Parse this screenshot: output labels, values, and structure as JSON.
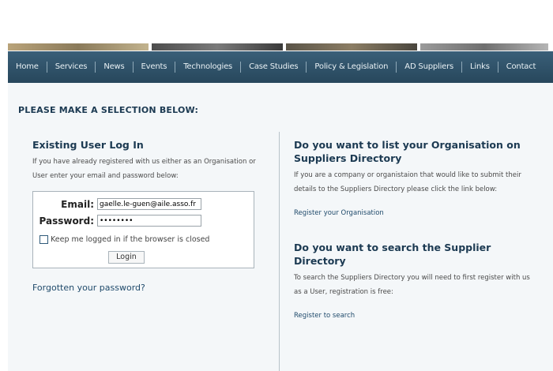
{
  "nav": {
    "items": [
      "Home",
      "Services",
      "News",
      "Events",
      "Technologies",
      "Case Studies",
      "Policy & Legislation",
      "AD Suppliers",
      "Links",
      "Contact"
    ]
  },
  "page": {
    "title": "PLEASE MAKE A SELECTION BELOW:"
  },
  "login": {
    "heading": "Existing User Log In",
    "description": "If you have already registered with us either as an Organisation or User enter your email and password below:",
    "email_label": "Email:",
    "email_value": "gaelle.le-guen@aile.asso.fr",
    "password_label": "Password:",
    "password_value": "password",
    "remember_label": "Keep me logged in if the browser is closed",
    "button_label": "Login",
    "forgot_label": "Forgotten your password?"
  },
  "list_org": {
    "heading": "Do you want to list your Organisation on Suppliers Directory",
    "description": "If you are a company or organistaion that would like to submit their details to the Suppliers Directory please click the link below:",
    "link": "Register your Organisation"
  },
  "search": {
    "heading": "Do you want to search the Supplier Directory",
    "description": "To search the Suppliers Directory you will need to first register with us as a User, registration is free:",
    "link": "Register to search"
  }
}
